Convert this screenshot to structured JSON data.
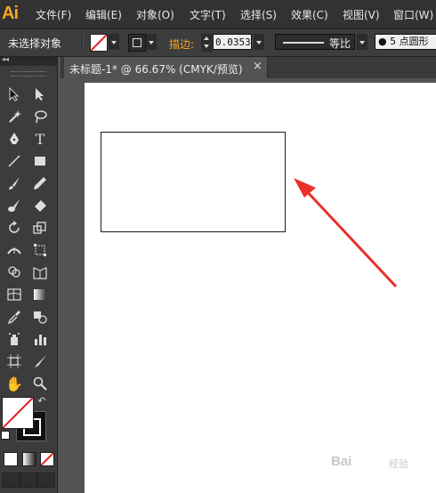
{
  "app": {
    "logo": "Ai"
  },
  "menu": [
    "文件(F)",
    "编辑(E)",
    "对象(O)",
    "文字(T)",
    "选择(S)",
    "效果(C)",
    "视图(V)",
    "窗口(W)"
  ],
  "control_bar": {
    "selection_status": "未选择对象",
    "stroke_label": "描边:",
    "stroke_weight": "0.0353",
    "stroke_profile": "等比",
    "brush_definition": "5 点圆形"
  },
  "document_tab": {
    "title": "未标题-1* @ 66.67% (CMYK/预览)",
    "close": "×"
  },
  "colors": {
    "menubar_bg": "#323232",
    "panel_bg": "#3c3c3c",
    "canvas_bg": "#535353",
    "accent_orange": "#f5a623",
    "annotation_arrow": "#e8312a"
  },
  "tools": [
    "selection-tool",
    "direct-selection-tool",
    "magic-wand-tool",
    "lasso-tool",
    "pen-tool",
    "type-tool",
    "line-segment-tool",
    "rectangle-tool",
    "paintbrush-tool",
    "pencil-tool",
    "blob-brush-tool",
    "eraser-tool",
    "rotate-tool",
    "scale-tool",
    "width-tool",
    "free-transform-tool",
    "shape-builder-tool",
    "perspective-grid-tool",
    "mesh-tool",
    "gradient-tool",
    "eyedropper-tool",
    "blend-tool",
    "symbol-sprayer-tool",
    "column-graph-tool",
    "artboard-tool",
    "slice-tool",
    "hand-tool",
    "zoom-tool"
  ],
  "watermark": {
    "text": "Bai",
    "suffix": "经验"
  }
}
